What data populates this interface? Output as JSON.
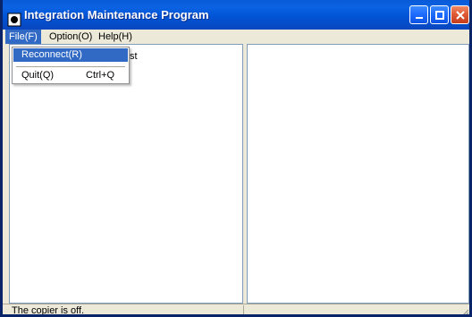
{
  "window": {
    "title": "Integration Maintenance Program",
    "icon": "app-icon",
    "buttons": [
      "minimize-icon",
      "maximize-icon",
      "close-icon"
    ]
  },
  "menu": {
    "file": "File(F)",
    "option": "Option(O)",
    "help": "Help(H)"
  },
  "file_menu": {
    "reconnect": "Reconnect(R)",
    "quit": "Quit(Q)",
    "quit_shortcut": "Ctrl+Q"
  },
  "left_pane": {
    "visible_text": "st"
  },
  "status": {
    "message": "The copier is off."
  },
  "colors": {
    "titlebar": "#0054d6",
    "menu_highlight": "#316ac5",
    "window_background": "#ece9d8",
    "pane_border": "#7f9db9"
  }
}
